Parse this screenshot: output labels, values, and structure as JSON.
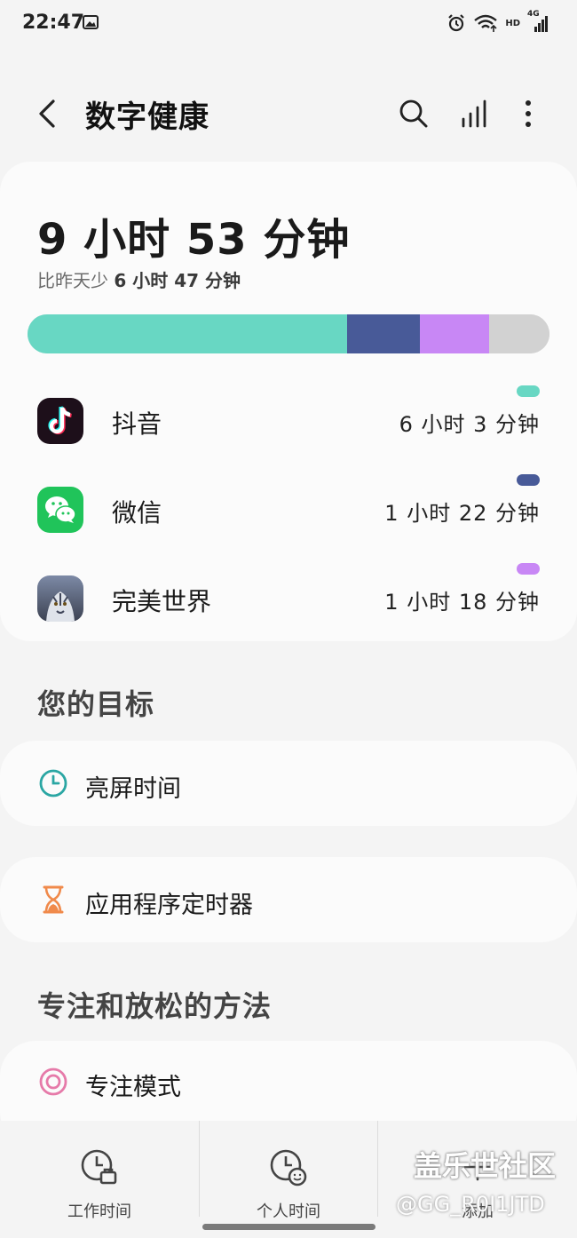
{
  "status_bar": {
    "time": "22:47",
    "hd": "HD",
    "network": "4G"
  },
  "header": {
    "title": "数字健康"
  },
  "usage": {
    "total": "9 小时 53 分钟",
    "compare_prefix": "比昨天少",
    "compare_value": "6 小时 47 分钟",
    "segments": [
      {
        "color": "#68d7c3",
        "fraction": 0.613
      },
      {
        "color": "#485a98",
        "fraction": 0.139
      },
      {
        "color": "#c887f5",
        "fraction": 0.133
      },
      {
        "color": "#d2d2d2",
        "fraction": 0.115
      }
    ],
    "apps": [
      {
        "name": "抖音",
        "time": "6 小时 3 分钟",
        "color": "#68d7c3",
        "icon": "douyin-icon"
      },
      {
        "name": "微信",
        "time": "1 小时 22 分钟",
        "color": "#485a98",
        "icon": "wechat-icon"
      },
      {
        "name": "完美世界",
        "time": "1 小时 18 分钟",
        "color": "#c887f5",
        "icon": "perfect-world-icon"
      }
    ]
  },
  "goals": {
    "title": "您的目标",
    "items": [
      {
        "label": "亮屏时间",
        "icon": "clock-icon"
      },
      {
        "label": "应用程序定时器",
        "icon": "hourglass-icon"
      }
    ]
  },
  "focus": {
    "title": "专注和放松的方法",
    "items": [
      {
        "label": "专注模式",
        "icon": "target-icon"
      }
    ]
  },
  "bottom_nav": {
    "items": [
      {
        "label": "工作时间",
        "icon": "work-time-icon"
      },
      {
        "label": "个人时间",
        "icon": "personal-time-icon"
      },
      {
        "label": "添加",
        "icon": "add-icon"
      }
    ]
  },
  "watermark": {
    "line1": "盖乐世社区",
    "line2": "@GG_R0I1JTD"
  }
}
